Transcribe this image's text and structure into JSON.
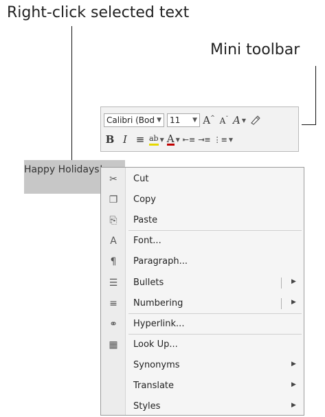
{
  "callouts": {
    "right_click": "Right-click selected text",
    "mini_toolbar": "Mini toolbar"
  },
  "document": {
    "selected_text": "Happy Holidays!"
  },
  "mini_toolbar": {
    "font_name": "Calibri (Bod",
    "font_size": "11",
    "row1": [
      {
        "name": "grow-font-button",
        "glyph": "Aˆ"
      },
      {
        "name": "shrink-font-button",
        "glyph": "Aˇ"
      },
      {
        "name": "styles-button",
        "glyph": "A"
      },
      {
        "name": "format-painter-button",
        "glyph": "🖌"
      }
    ],
    "row2": [
      {
        "name": "bold-button",
        "glyph": "B"
      },
      {
        "name": "italic-button",
        "glyph": "I"
      },
      {
        "name": "center-button",
        "glyph": "≡"
      },
      {
        "name": "highlight-button",
        "glyph": "ab"
      },
      {
        "name": "font-color-button",
        "glyph": "A"
      },
      {
        "name": "decrease-indent-button",
        "glyph": "⇤"
      },
      {
        "name": "increase-indent-button",
        "glyph": "⇥"
      },
      {
        "name": "bullets-button",
        "glyph": "☰"
      }
    ]
  },
  "context_menu": {
    "items": [
      {
        "name": "cut",
        "label": "Cut",
        "icon": "scissors-icon",
        "glyph": "✂",
        "submenu": false,
        "split": false
      },
      {
        "name": "copy",
        "label": "Copy",
        "icon": "copy-icon",
        "glyph": "❐",
        "submenu": false,
        "split": false
      },
      {
        "name": "paste",
        "label": "Paste",
        "icon": "paste-icon",
        "glyph": "⎘",
        "submenu": false,
        "split": false
      },
      {
        "name": "font",
        "label": "Font...",
        "icon": "font-icon",
        "glyph": "A",
        "submenu": false,
        "split": false
      },
      {
        "name": "paragraph",
        "label": "Paragraph...",
        "icon": "paragraph-icon",
        "glyph": "¶",
        "submenu": false,
        "split": false
      },
      {
        "name": "bullets",
        "label": "Bullets",
        "icon": "bullets-icon",
        "glyph": "☰",
        "submenu": true,
        "split": true
      },
      {
        "name": "numbering",
        "label": "Numbering",
        "icon": "numbering-icon",
        "glyph": "≡",
        "submenu": true,
        "split": true
      },
      {
        "name": "hyperlink",
        "label": "Hyperlink...",
        "icon": "hyperlink-icon",
        "glyph": "⚭",
        "submenu": false,
        "split": false
      },
      {
        "name": "look-up",
        "label": "Look Up...",
        "icon": "look-up-icon",
        "glyph": "▦",
        "submenu": false,
        "split": false
      },
      {
        "name": "synonyms",
        "label": "Synonyms",
        "icon": "",
        "glyph": "",
        "submenu": true,
        "split": false
      },
      {
        "name": "translate",
        "label": "Translate",
        "icon": "",
        "glyph": "",
        "submenu": true,
        "split": false
      },
      {
        "name": "styles",
        "label": "Styles",
        "icon": "",
        "glyph": "",
        "submenu": true,
        "split": false
      }
    ],
    "submenu_arrow": "▶"
  }
}
